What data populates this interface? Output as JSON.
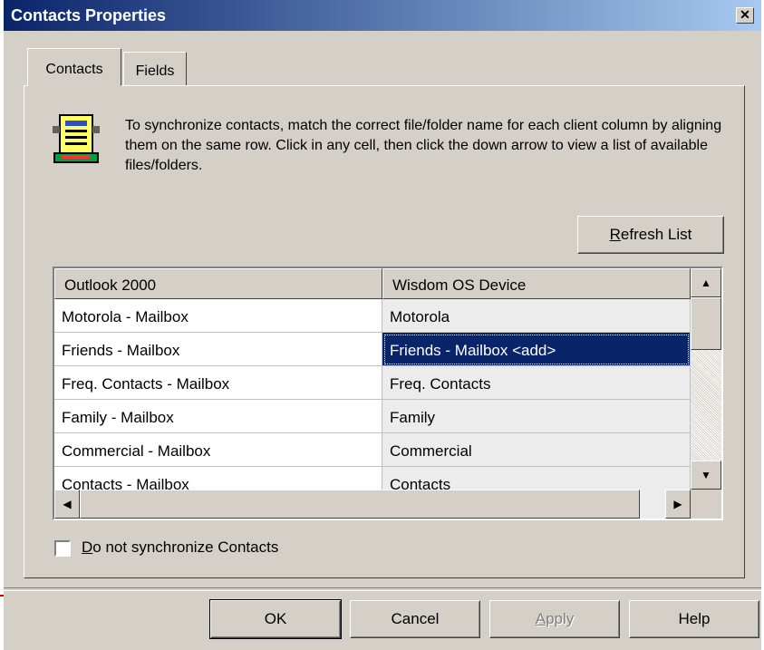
{
  "window": {
    "title": "Contacts Properties",
    "close_glyph": "✕"
  },
  "tabs": [
    {
      "label": "Contacts",
      "active": true
    },
    {
      "label": "Fields",
      "active": false
    }
  ],
  "info": {
    "icon": "address-card-icon",
    "text": "To synchronize contacts, match the correct file/folder name for each client column by aligning them on the same row. Click in any cell, then click the down arrow to view a list of available files/folders."
  },
  "refresh_button": {
    "mnemonic": "R",
    "rest": "efresh List"
  },
  "grid": {
    "columns": [
      "Outlook 2000",
      "Wisdom OS Device"
    ],
    "rows": [
      {
        "outlook": "Motorola - Mailbox",
        "device": "Motorola"
      },
      {
        "outlook": "Friends - Mailbox",
        "device": "Friends - Mailbox  <add>",
        "selected": true
      },
      {
        "outlook": "Freq. Contacts - Mailbox",
        "device": "Freq. Contacts"
      },
      {
        "outlook": "Family - Mailbox",
        "device": "Family"
      },
      {
        "outlook": "Commercial - Mailbox",
        "device": "Commercial"
      },
      {
        "outlook": "Contacts - Mailbox",
        "device": "Contacts"
      }
    ]
  },
  "checkbox": {
    "mnemonic": "D",
    "rest": "o not synchronize Contacts",
    "checked": false
  },
  "buttons": {
    "ok": "OK",
    "cancel": "Cancel",
    "apply_mnemonic": "A",
    "apply_rest": "pply",
    "help": "Help"
  },
  "colors": {
    "titlebar_start": "#0a246a",
    "titlebar_end": "#a6caf0",
    "dialog_face": "#d4d0c8",
    "selection": "#0a246a"
  }
}
